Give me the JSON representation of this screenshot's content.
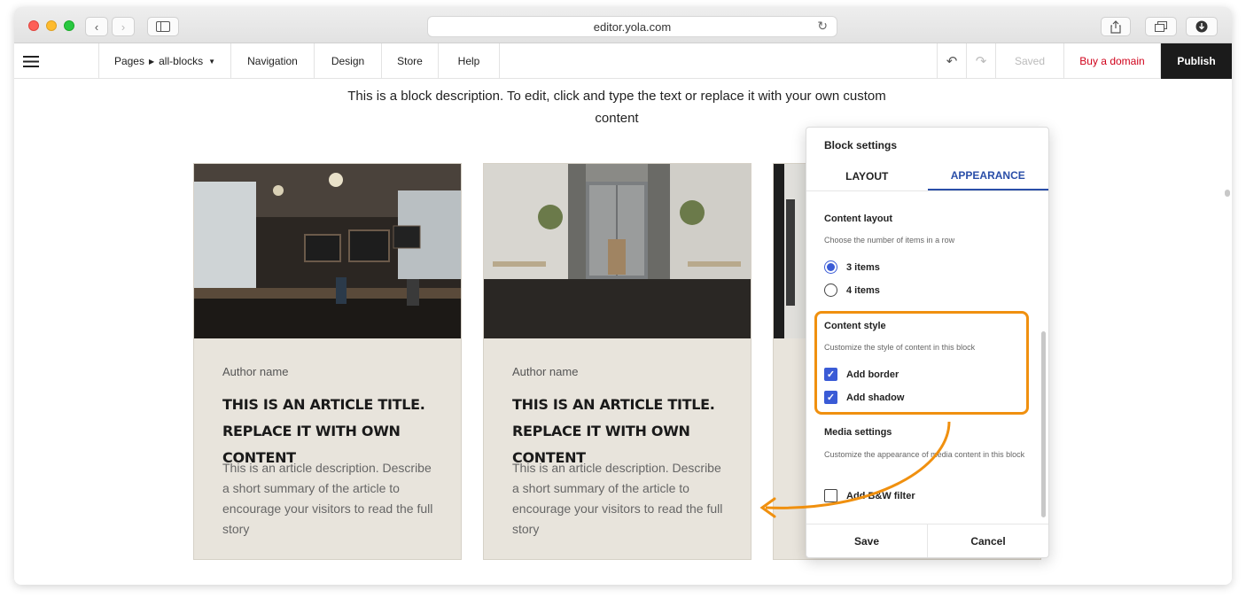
{
  "browser": {
    "url": "editor.yola.com"
  },
  "toolbar": {
    "pages_label": "Pages",
    "page_name": "all-blocks",
    "navigation": "Navigation",
    "design": "Design",
    "store": "Store",
    "help": "Help",
    "saved": "Saved",
    "buy_domain": "Buy a domain",
    "publish": "Publish"
  },
  "page": {
    "description": "This is a block description. To edit, click and type the text or replace it with your own custom content",
    "cards": [
      {
        "author": "Author name",
        "title": "THIS IS AN ARTICLE TITLE. REPLACE IT WITH OWN CONTENT",
        "description": "This is an article description. Describe a short summary of the article to encourage your visitors to read the full story"
      },
      {
        "author": "Author name",
        "title": "THIS IS AN ARTICLE TITLE. REPLACE IT WITH OWN CONTENT",
        "description": "This is an article description. Describe a short summary of the article to encourage your visitors to read the full story"
      }
    ]
  },
  "block_settings": {
    "header": "Block settings",
    "tabs": [
      {
        "label": "LAYOUT",
        "active": false
      },
      {
        "label": "APPEARANCE",
        "active": true
      }
    ],
    "content_layout": {
      "title": "Content layout",
      "subtitle": "Choose the number of items in a row",
      "options": [
        {
          "label": "3 items",
          "selected": true
        },
        {
          "label": "4 items",
          "selected": false
        }
      ]
    },
    "content_style": {
      "title": "Content style",
      "subtitle": "Customize the style of content in this block",
      "options": [
        {
          "label": "Add border",
          "checked": true
        },
        {
          "label": "Add shadow",
          "checked": true
        }
      ]
    },
    "media_settings": {
      "title": "Media settings",
      "subtitle": "Customize the appearance of media content in this block",
      "options": [
        {
          "label": "Add B&W filter",
          "checked": false
        }
      ]
    },
    "save": "Save",
    "cancel": "Cancel"
  },
  "colors": {
    "accent": "#3a5bd6",
    "highlight": "#f0900f",
    "card_bg": "#e8e4dc",
    "buy_domain": "#d0021b",
    "publish_bg": "#1b1b1b"
  }
}
